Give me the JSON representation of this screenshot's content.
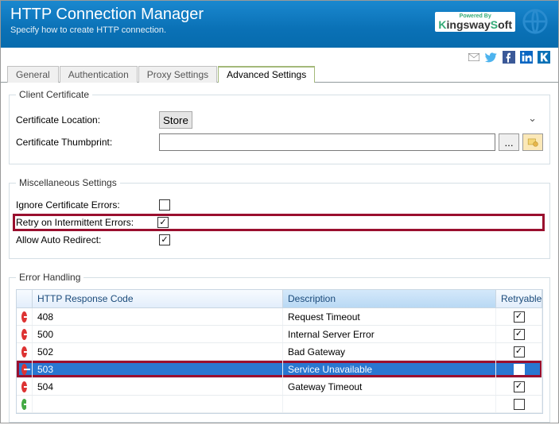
{
  "header": {
    "title": "HTTP Connection Manager",
    "subtitle": "Specify how to create HTTP connection.",
    "powered_by": "Powered By",
    "brand": "KingswaySoft"
  },
  "tabs": {
    "items": [
      "General",
      "Authentication",
      "Proxy Settings",
      "Advanced Settings"
    ],
    "active": 3
  },
  "client_cert": {
    "legend": "Client Certificate",
    "loc_label": "Certificate Location:",
    "loc_value": "Store",
    "thumb_label": "Certificate Thumbprint:",
    "thumb_value": "",
    "browse": "...",
    "clear": ""
  },
  "misc": {
    "legend": "Miscellaneous Settings",
    "ignore_label": "Ignore Certificate Errors:",
    "ignore_checked": false,
    "retry_label": "Retry on Intermittent Errors:",
    "retry_checked": true,
    "redirect_label": "Allow Auto Redirect:",
    "redirect_checked": true
  },
  "error_handling": {
    "legend": "Error Handling",
    "columns": {
      "code": "HTTP Response Code",
      "desc": "Description",
      "retry": "Retryable"
    },
    "rows": [
      {
        "code": "408",
        "desc": "Request Timeout",
        "retry": true,
        "selected": false
      },
      {
        "code": "500",
        "desc": "Internal Server Error",
        "retry": true,
        "selected": false
      },
      {
        "code": "502",
        "desc": "Bad Gateway",
        "retry": true,
        "selected": false
      },
      {
        "code": "503",
        "desc": "Service Unavailable",
        "retry": true,
        "selected": true
      },
      {
        "code": "504",
        "desc": "Gateway Timeout",
        "retry": true,
        "selected": false
      }
    ]
  }
}
